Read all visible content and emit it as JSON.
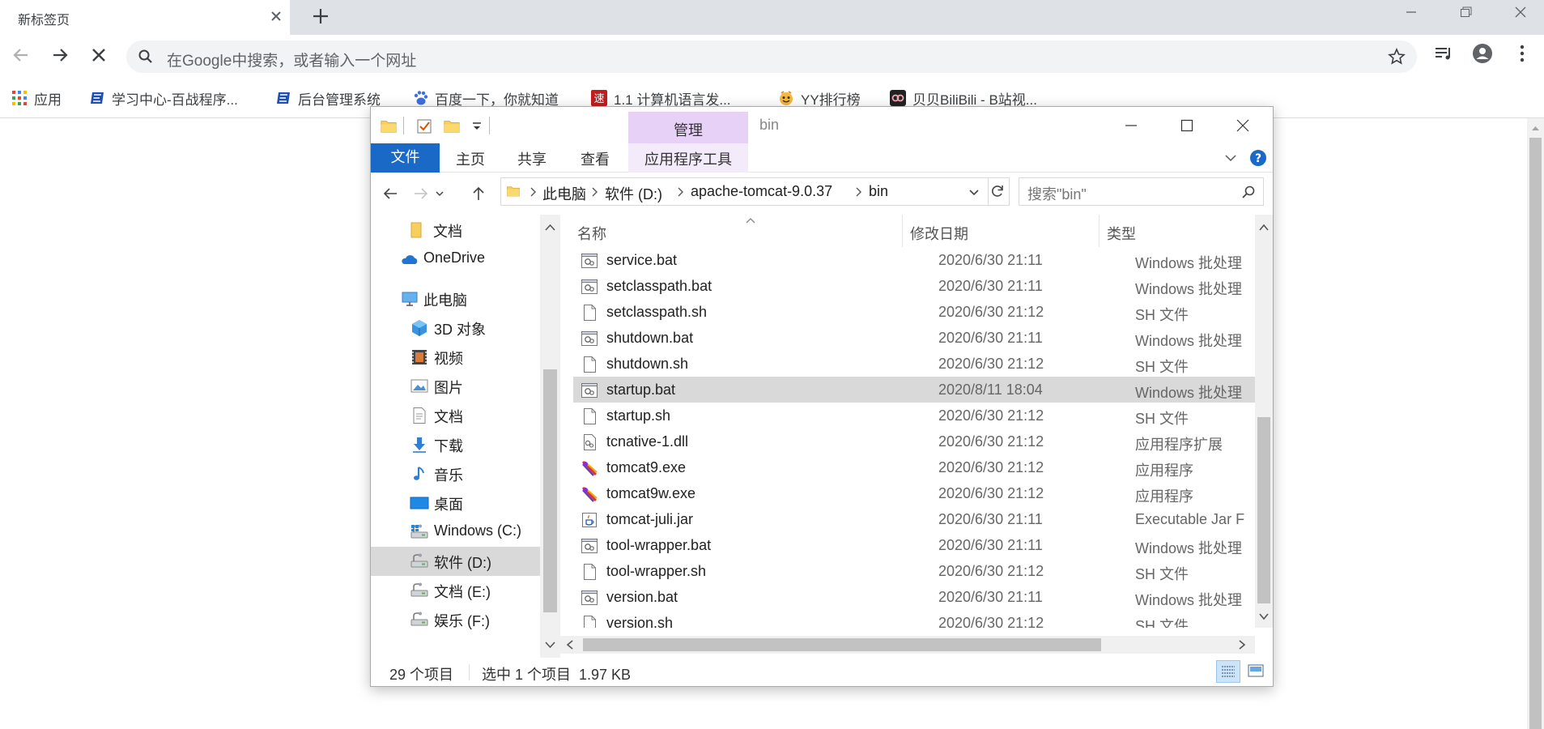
{
  "browser": {
    "tab_title": "新标签页",
    "omnibox_placeholder": "在Google中搜索，或者输入一个网址",
    "bookmarks": [
      {
        "label": "应用",
        "icon": "apps-grid-icon"
      },
      {
        "label": "学习中心-百战程序...",
        "icon": "bookmark-site-icon"
      },
      {
        "label": "后台管理系统",
        "icon": "bookmark-site-icon"
      },
      {
        "label": "百度一下，你就知道",
        "icon": "baidu-paw-icon"
      },
      {
        "label": "1.1 计算机语言发...",
        "icon": "su-badge-icon"
      },
      {
        "label": "YY排行榜",
        "icon": "yy-icon"
      },
      {
        "label": "贝贝BiliBili - B站视...",
        "icon": "bilibili-icon"
      }
    ],
    "su_badge_text": "速"
  },
  "explorer": {
    "title": "bin",
    "context_tab": "管理",
    "ribbon_tabs": [
      "文件",
      "主页",
      "共享",
      "查看"
    ],
    "context_subtab": "应用程序工具",
    "breadcrumbs": [
      "此电脑",
      "软件 (D:)",
      "apache-tomcat-9.0.37",
      "bin"
    ],
    "search_placeholder": "搜索\"bin\"",
    "nav_items": [
      {
        "label": "文档",
        "icon": "folder-icon"
      },
      {
        "label": "OneDrive",
        "icon": "onedrive-cloud-icon"
      },
      {
        "label": "此电脑",
        "icon": "this-pc-icon"
      },
      {
        "label": "3D 对象",
        "icon": "3d-objects-icon"
      },
      {
        "label": "视频",
        "icon": "videos-icon"
      },
      {
        "label": "图片",
        "icon": "pictures-icon"
      },
      {
        "label": "文档",
        "icon": "documents-icon"
      },
      {
        "label": "下载",
        "icon": "downloads-icon"
      },
      {
        "label": "音乐",
        "icon": "music-icon"
      },
      {
        "label": "桌面",
        "icon": "desktop-icon"
      },
      {
        "label": "Windows (C:)",
        "icon": "windows-drive-icon"
      },
      {
        "label": "软件 (D:)",
        "icon": "drive-icon",
        "selected": true
      },
      {
        "label": "文档 (E:)",
        "icon": "drive-icon"
      },
      {
        "label": "娱乐 (F:)",
        "icon": "drive-icon"
      }
    ],
    "columns": {
      "name": "名称",
      "date": "修改日期",
      "type": "类型"
    },
    "files": [
      {
        "name": "service.bat",
        "date": "2020/6/30 21:11",
        "type": "Windows 批处理",
        "icon": "batch-file-icon"
      },
      {
        "name": "setclasspath.bat",
        "date": "2020/6/30 21:11",
        "type": "Windows 批处理",
        "icon": "batch-file-icon"
      },
      {
        "name": "setclasspath.sh",
        "date": "2020/6/30 21:12",
        "type": "SH 文件",
        "icon": "blank-file-icon"
      },
      {
        "name": "shutdown.bat",
        "date": "2020/6/30 21:11",
        "type": "Windows 批处理",
        "icon": "batch-file-icon"
      },
      {
        "name": "shutdown.sh",
        "date": "2020/6/30 21:12",
        "type": "SH 文件",
        "icon": "blank-file-icon"
      },
      {
        "name": "startup.bat",
        "date": "2020/8/11 18:04",
        "type": "Windows 批处理",
        "icon": "batch-file-icon",
        "selected": true
      },
      {
        "name": "startup.sh",
        "date": "2020/6/30 21:12",
        "type": "SH 文件",
        "icon": "blank-file-icon"
      },
      {
        "name": "tcnative-1.dll",
        "date": "2020/6/30 21:12",
        "type": "应用程序扩展",
        "icon": "dll-file-icon"
      },
      {
        "name": "tomcat9.exe",
        "date": "2020/6/30 21:12",
        "type": "应用程序",
        "icon": "tomcat-exe-icon"
      },
      {
        "name": "tomcat9w.exe",
        "date": "2020/6/30 21:12",
        "type": "应用程序",
        "icon": "tomcat-exe-icon"
      },
      {
        "name": "tomcat-juli.jar",
        "date": "2020/6/30 21:11",
        "type": "Executable Jar F",
        "icon": "jar-file-icon"
      },
      {
        "name": "tool-wrapper.bat",
        "date": "2020/6/30 21:11",
        "type": "Windows 批处理",
        "icon": "batch-file-icon"
      },
      {
        "name": "tool-wrapper.sh",
        "date": "2020/6/30 21:12",
        "type": "SH 文件",
        "icon": "blank-file-icon"
      },
      {
        "name": "version.bat",
        "date": "2020/6/30 21:11",
        "type": "Windows 批处理",
        "icon": "batch-file-icon"
      },
      {
        "name": "version.sh",
        "date": "2020/6/30 21:12",
        "type": "SH 文件",
        "icon": "blank-file-icon"
      }
    ],
    "status": {
      "count": "29 个项目",
      "selection": "选中 1 个项目  1.97 KB"
    }
  },
  "colors": {
    "accent": "#1a69c7",
    "context_tab": "#e8d1f7",
    "selection": "#d9d9d9"
  }
}
